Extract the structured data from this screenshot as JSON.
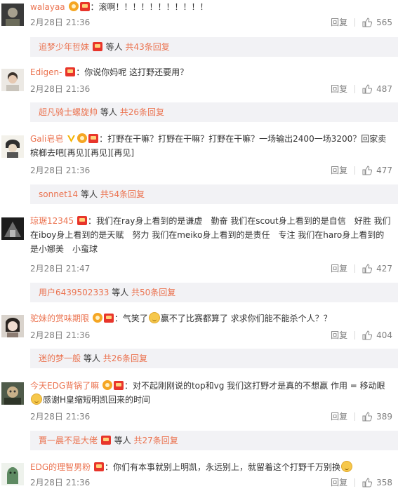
{
  "comments": [
    {
      "user": "walayaa",
      "badges": [
        "medal",
        "red"
      ],
      "text": "：滚啊！！！！！！！！！！！",
      "time": "2月28日 21:36",
      "reply_label": "回复",
      "likes": "565",
      "sub": {
        "names": "追梦少年哲妹",
        "badge": true,
        "etc": "等人",
        "count": "共43条回复"
      }
    },
    {
      "user": "Edigen-",
      "badges": [
        "red"
      ],
      "text": "：你说你妈呢 这打野还要用？",
      "time": "2月28日 21:36",
      "reply_label": "回复",
      "likes": "487",
      "sub": {
        "names": "超凡骑士螺旋帅",
        "badge": false,
        "etc": "等人",
        "count": "共26条回复"
      }
    },
    {
      "user": "Gali皂皂",
      "badges": [
        "v",
        "medal",
        "red"
      ],
      "text": "：打野在干嘛？打野在干嘛？打野在干嘛？一场输出2400一场3200？回家卖槟榔去吧[再见][再见][再见]",
      "time": "2月28日 21:36",
      "reply_label": "回复",
      "likes": "477",
      "sub": {
        "names": "sonnet14",
        "badge": false,
        "etc": "等人",
        "count": "共54条回复"
      }
    },
    {
      "user": "琼琚12345",
      "badges": [
        "red"
      ],
      "text": "：我们在ray身上看到的是谦虚　勤奋 我们在scout身上看到的是自信　好胜 我们在iboy身上看到的是天赋　努力 我们在meiko身上看到的是责任　专注 我们在haro身上看到的是小娜美　小蛮球",
      "time": "2月28日 21:47",
      "reply_label": "回复",
      "likes": "427",
      "sub": {
        "names": "用户6439502333",
        "badge": false,
        "etc": "等人",
        "count": "共50条回复"
      }
    },
    {
      "user": "驼妹的赏味期限",
      "badges": [
        "medal",
        "red"
      ],
      "text_before": "：气笑了",
      "text_after": "赢不了比赛都算了 求求你们能不能杀个人？？",
      "time": "2月28日 21:36",
      "reply_label": "回复",
      "likes": "404",
      "sub": {
        "names": "迷的梦一般",
        "badge": false,
        "etc": "等人",
        "count": "共26条回复"
      }
    },
    {
      "user": "今天EDG背锅了嘛",
      "badges": [
        "medal",
        "red"
      ],
      "text_before": "：对不起刚刚说的top和vg 我们这打野才是真的不想赢 作用 = 移动眼",
      "text_after": "感谢H皇缩短明凯回来的时间",
      "time": "2月28日 21:36",
      "reply_label": "回复",
      "likes": "389",
      "sub": {
        "names": "賈一晨不是大佬",
        "badge": true,
        "etc": "等人",
        "count": "共27条回复"
      }
    },
    {
      "user": "EDG的理智男粉",
      "badges": [
        "red"
      ],
      "text_before": "：你们有本事就别上明凯，永远别上，就留着这个打野千万别换",
      "text_after": "",
      "time": "2月28日 21:36",
      "reply_label": "回复",
      "likes": "358"
    }
  ]
}
